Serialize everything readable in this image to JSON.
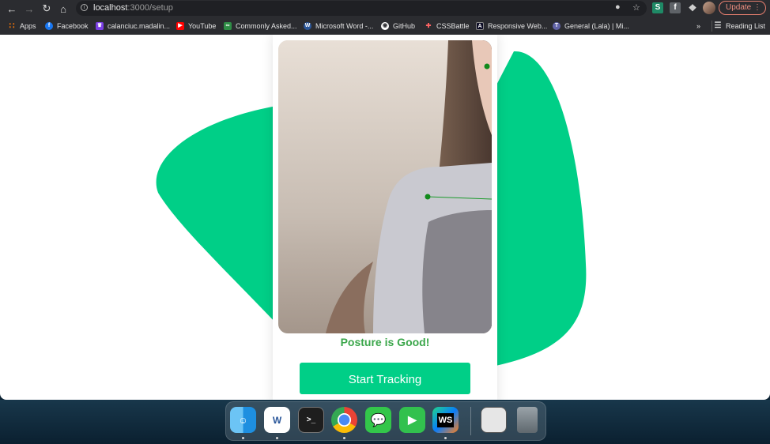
{
  "browser": {
    "url_host": "localhost",
    "url_path": ":3000/setup",
    "update_label": "Update",
    "bookmarks": [
      {
        "label": "Apps",
        "icon": "apps-grid-icon",
        "color": "#e8710a"
      },
      {
        "label": "Facebook",
        "icon": "facebook-icon",
        "color": "#1877f2"
      },
      {
        "label": "calanciuc.madalin...",
        "icon": "crown-icon",
        "color": "#7b3fe4"
      },
      {
        "label": "YouTube",
        "icon": "youtube-icon",
        "color": "#ff0000"
      },
      {
        "label": "Commonly Asked...",
        "icon": "link-icon",
        "color": "#2f8d46"
      },
      {
        "label": "Microsoft Word -...",
        "icon": "word-icon",
        "color": "#2b579a"
      },
      {
        "label": "GitHub",
        "icon": "github-icon",
        "color": "#ffffff"
      },
      {
        "label": "CSSBattle",
        "icon": "cssbattle-icon",
        "color": "#ff6464"
      },
      {
        "label": "Responsive Web...",
        "icon": "freecodecamp-icon",
        "color": "#0a0a23"
      },
      {
        "label": "General (Lala) | Mi...",
        "icon": "teams-icon",
        "color": "#6264a7"
      }
    ],
    "more_label": "»",
    "reading_list_label": "Reading List"
  },
  "app": {
    "status": "Posture is Good!",
    "start_button": "Start Tracking",
    "accent": "#00cf87",
    "status_color": "#3aa64a"
  },
  "dock": {
    "apps": [
      "finder-icon",
      "word-icon",
      "terminal-icon",
      "chrome-icon",
      "messages-icon",
      "facetime-icon",
      "webstorm-icon",
      "preview-window-icon",
      "trash-icon"
    ]
  }
}
